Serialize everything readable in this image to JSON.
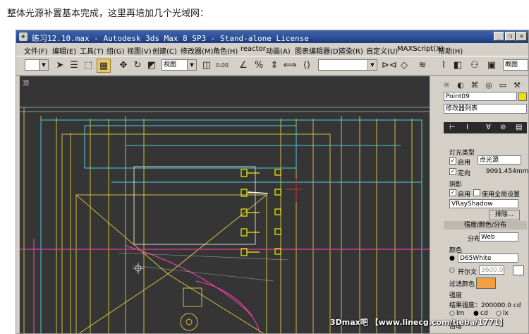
{
  "post": {
    "text": "整体光源补置基本完成，这里再培加几个光域网："
  },
  "window": {
    "title": "练习12.10.max - Autodesk 3ds Max 8 SP3 - Stand-alone License",
    "icon": "max"
  },
  "menu": [
    "文件(F)",
    "编辑(E)",
    "工具(T)",
    "组(G)",
    "视图(V)",
    "创建(C)",
    "修改器(M)",
    "角色(H)",
    "reactor",
    "动画(A)",
    "图表编辑器(D)",
    "渲染(R)",
    "自定义(U)",
    "MAXScript(X)",
    "帮助(H)"
  ],
  "toolbar": {
    "view_combo": "视图",
    "render_combo": "概图",
    "snap_value": "0.00"
  },
  "viewport": {
    "label": "顶"
  },
  "panel": {
    "object_name": "Point09",
    "modifier_list": "修改器列表",
    "light_type_header": "灯光类型",
    "enable_label": "启用",
    "light_type_value": "点光源",
    "targeted_label": "定向",
    "targeted_value": "9091.454mm",
    "shadows_header": "阴影",
    "shadow_enable_label": "启用",
    "global_label": "使用全局设置",
    "shadow_type": "VRayShadow",
    "exclude_button": "排除...",
    "rollout_title": "强度/颜色/分布",
    "distribution_label": "分布",
    "distribution_value": "Web",
    "color_header": "颜色",
    "color_preset": "D65White",
    "kelvin_label": "开尔文",
    "kelvin_value": "3600.0",
    "filter_label": "过滤颜色",
    "intensity_header": "强度",
    "result_label": "结果强度：200000.0 cd",
    "unit_lm": "lm",
    "unit_cd": "cd",
    "unit_lx": "lx",
    "multiplier_label": "倍增"
  },
  "watermark": "3Dmax吧 【www.linecg.com/tieba/1771】",
  "colors": {
    "title_bar": "#1e3c80",
    "viewport_bg": "#353535",
    "filter_color": "#f0a040",
    "object_color": "#f0e000"
  }
}
